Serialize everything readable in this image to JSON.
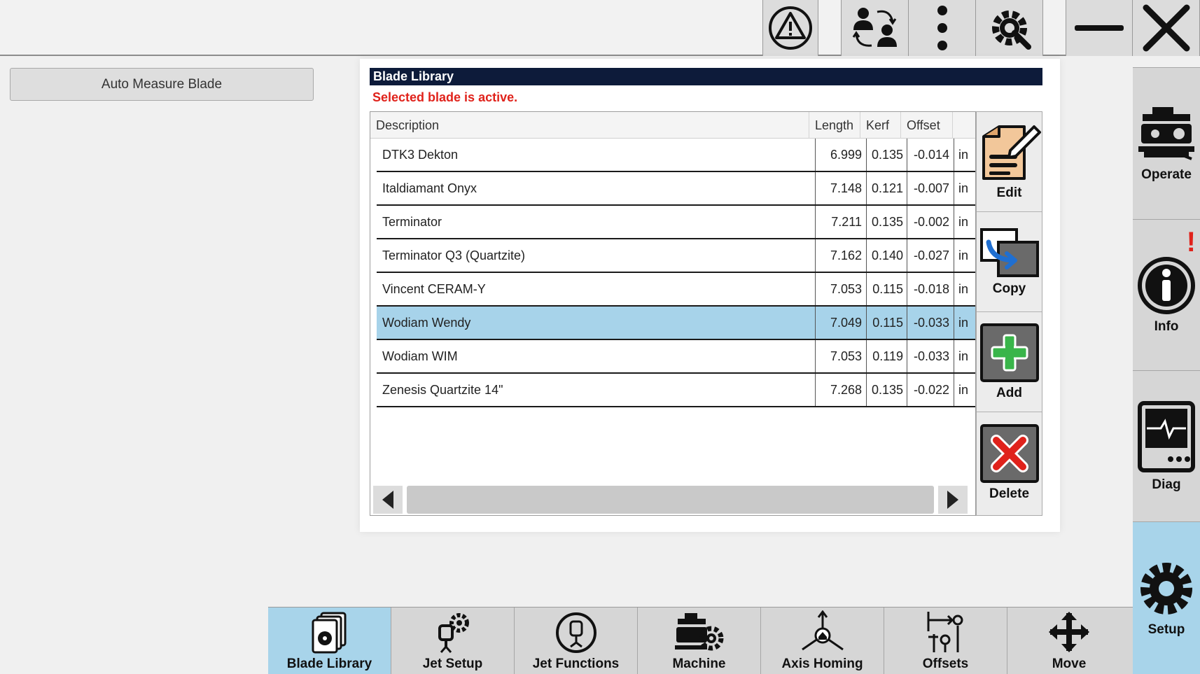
{
  "left_panel": {
    "auto_measure_label": "Auto Measure Blade"
  },
  "dialog": {
    "title": "Blade Library",
    "status": "Selected blade is active.",
    "columns": [
      "Description",
      "Length",
      "Kerf",
      "Offset"
    ],
    "rows": [
      {
        "description": "DTK3 Dekton",
        "length": "6.999",
        "kerf": "0.135",
        "offset": "-0.014",
        "unit": "in"
      },
      {
        "description": "Italdiamant Onyx",
        "length": "7.148",
        "kerf": "0.121",
        "offset": "-0.007",
        "unit": "in"
      },
      {
        "description": "Terminator",
        "length": "7.211",
        "kerf": "0.135",
        "offset": "-0.002",
        "unit": "in"
      },
      {
        "description": "Terminator Q3 (Quartzite)",
        "length": "7.162",
        "kerf": "0.140",
        "offset": "-0.027",
        "unit": "in"
      },
      {
        "description": "Vincent CERAM-Y",
        "length": "7.053",
        "kerf": "0.115",
        "offset": "-0.018",
        "unit": "in"
      },
      {
        "description": "Wodiam Wendy",
        "length": "7.049",
        "kerf": "0.115",
        "offset": "-0.033",
        "unit": "in"
      },
      {
        "description": "Wodiam WIM",
        "length": "7.053",
        "kerf": "0.119",
        "offset": "-0.033",
        "unit": "in"
      },
      {
        "description": "Zenesis Quartzite 14\"",
        "length": "7.268",
        "kerf": "0.135",
        "offset": "-0.022",
        "unit": "in"
      }
    ],
    "selected_row": "Wodiam Wendy",
    "actions": {
      "edit": "Edit",
      "copy": "Copy",
      "add": "Add",
      "delete": "Delete"
    }
  },
  "right_nav": {
    "operate": "Operate",
    "info": "Info",
    "info_alert": "!",
    "diag": "Diag",
    "setup": "Setup"
  },
  "bottom_nav": {
    "blade_library": "Blade Library",
    "jet_setup": "Jet Setup",
    "jet_functions": "Jet Functions",
    "machine": "Machine",
    "axis_homing": "Axis Homing",
    "offsets": "Offsets",
    "move": "Move"
  },
  "icons": {
    "top": [
      "warning-icon",
      "user-switch-icon",
      "more-vertical-icon",
      "settings-tools-icon",
      "minimize-icon",
      "close-icon"
    ]
  },
  "colors": {
    "title_bar": "#0d1b3a",
    "status_red": "#e0221b",
    "selected_row": "#a7d3ea",
    "active_nav": "#a8d4ea"
  }
}
